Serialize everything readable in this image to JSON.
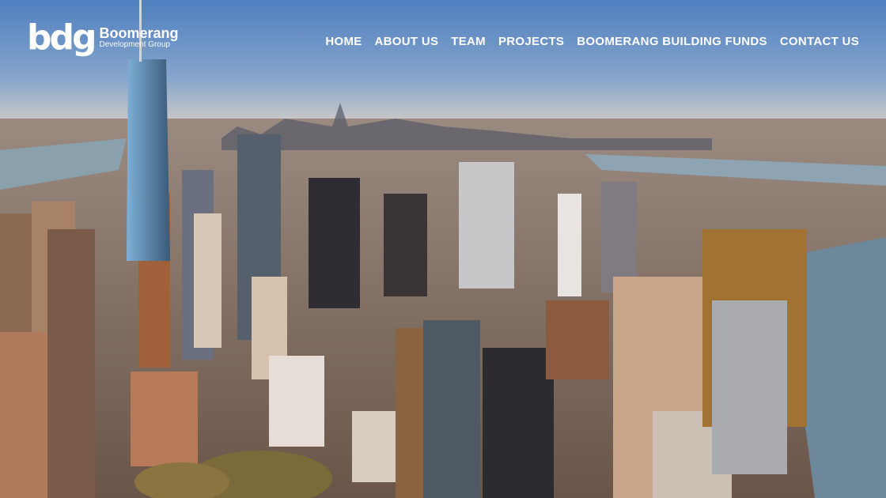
{
  "brand": {
    "mark": "bdg",
    "name": "Boomerang",
    "tagline": "Development Group"
  },
  "nav": {
    "items": [
      {
        "label": "HOME"
      },
      {
        "label": "ABOUT US"
      },
      {
        "label": "TEAM"
      },
      {
        "label": "PROJECTS"
      },
      {
        "label": "BOOMERANG BUILDING FUNDS"
      },
      {
        "label": "CONTACT US"
      }
    ]
  },
  "hero": {
    "image": "aerial-city-skyline",
    "colors": {
      "sky_top": "#5d86bd",
      "sky_bottom": "#d8cbc0",
      "water": "#6d879b",
      "city_dark": "#3b3a3d",
      "city_warm": "#b57f58",
      "city_light": "#d7b59a"
    }
  }
}
